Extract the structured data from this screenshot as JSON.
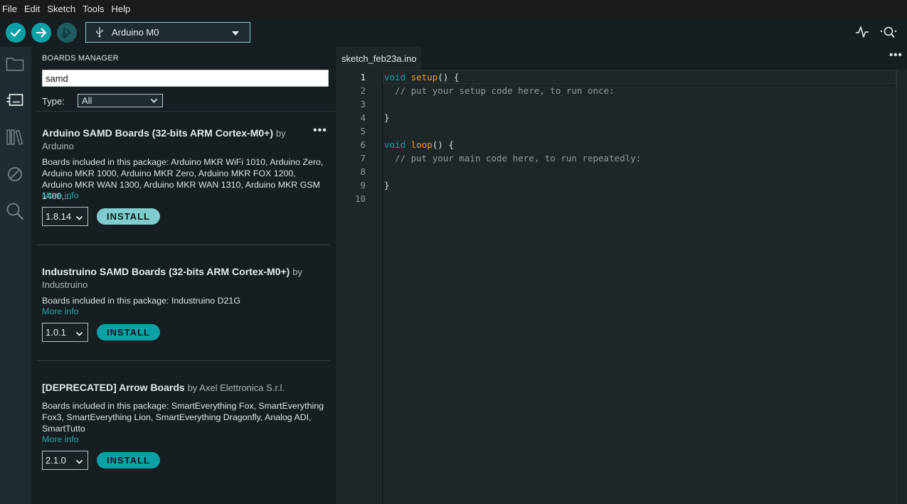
{
  "menu": [
    "File",
    "Edit",
    "Sketch",
    "Tools",
    "Help"
  ],
  "toolbar": {
    "board_name": "Arduino M0",
    "verify_icon": "check-icon",
    "upload_icon": "arrow-right-icon",
    "debug_icon": "debug-icon",
    "plotter_icon": "serial-plotter-icon",
    "monitor_icon": "serial-monitor-icon"
  },
  "activity": [
    "folder-icon",
    "boards-manager-icon",
    "library-icon",
    "debug-disabled-icon",
    "search-icon"
  ],
  "boards_manager": {
    "title": "BOARDS MANAGER",
    "search_value": "samd",
    "type_label": "Type:",
    "type_value": "All",
    "boards": [
      {
        "name": "Arduino SAMD Boards (32-bits ARM Cortex-M0+)",
        "by": "by",
        "author": "Arduino",
        "description": "Boards included in this package: Arduino MKR WiFi 1010, Arduino Zero, Arduino MKR 1000, Arduino MKR Zero, Arduino MKR FOX 1200, Arduino MKR WAN 1300, Arduino MKR WAN 1310, Arduino MKR GSM 1400,...",
        "more_info": "More info",
        "version": "1.8.14",
        "install": "INSTALL",
        "more": "•••"
      },
      {
        "name": "Industruino SAMD Boards (32-bits ARM Cortex-M0+)",
        "by": "by",
        "author": "Industruino",
        "description": "Boards included in this package: Industruino D21G",
        "more_info": "More info",
        "version": "1.0.1",
        "install": "INSTALL"
      },
      {
        "name": "[DEPRECATED] Arrow Boards",
        "by": "by Axel Elettronica S.r.l.",
        "description": "Boards included in this package: SmartEverything Fox, SmartEverything Fox3, SmartEverything Lion, SmartEverything Dragonfly, Analog ADI, SmartTutto",
        "more_info": "More info",
        "version": "2.1.0",
        "install": "INSTALL"
      }
    ]
  },
  "editor": {
    "tab": "sketch_feb23a.ino",
    "more": "•••",
    "line_numbers": [
      "1",
      "2",
      "3",
      "4",
      "5",
      "6",
      "7",
      "8",
      "9",
      "10"
    ],
    "code": {
      "kw1": "void",
      "fn1": "setup",
      "rest1": "() {",
      "comment1": "  // put your setup code here, to run once:",
      "close1": "}",
      "kw2": "void",
      "fn2": "loop",
      "rest2": "() {",
      "comment2": "  // put your main code here, to run repeatedly:",
      "close2": "}"
    }
  },
  "colors": {
    "accent": "#0ca1a6",
    "keyword": "#0ca1a6",
    "function": "#f39c12",
    "comment": "#8d9a9c"
  }
}
